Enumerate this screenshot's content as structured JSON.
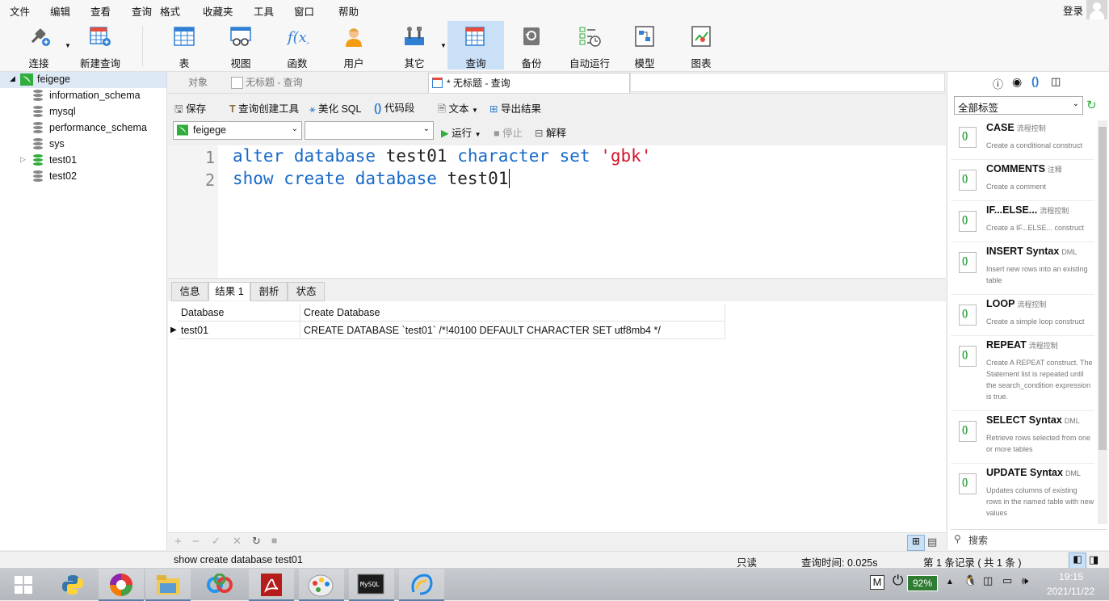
{
  "menu": [
    "文件",
    "编辑",
    "查看",
    "查询",
    "格式",
    "收藏夹",
    "工具",
    "窗口",
    "帮助"
  ],
  "login": "登录",
  "toolbar": {
    "connect": "连接",
    "new_query": "新建查询",
    "table": "表",
    "view": "视图",
    "function": "函数",
    "user": "用户",
    "other": "其它",
    "query": "查询",
    "backup": "备份",
    "auto_run": "自动运行",
    "model": "模型",
    "chart": "图表"
  },
  "tree": {
    "connection": "feigege",
    "databases": [
      "information_schema",
      "mysql",
      "performance_schema",
      "sys",
      "test01",
      "test02"
    ]
  },
  "tabs": {
    "objects": "对象",
    "untitled1": "无标题 - 查询",
    "untitled2": "* 无标题 - 查询"
  },
  "query_toolbar": {
    "save": "保存",
    "builder": "查询创建工具",
    "beautify": "美化 SQL",
    "snippet": "代码段",
    "text": "文本",
    "export": "导出结果",
    "connection": "feigege",
    "database": "",
    "run": "运行",
    "stop": "停止",
    "explain": "解释"
  },
  "editor": {
    "lines": [
      {
        "num": "1",
        "parts": [
          [
            "kw",
            "alter"
          ],
          [
            "sp",
            " "
          ],
          [
            "kw",
            "database"
          ],
          [
            "sp",
            " "
          ],
          [
            "id",
            "test01"
          ],
          [
            "sp",
            " "
          ],
          [
            "kw",
            "character"
          ],
          [
            "sp",
            " "
          ],
          [
            "kw",
            "set"
          ],
          [
            "sp",
            " "
          ],
          [
            "str",
            "'gbk'"
          ]
        ]
      },
      {
        "num": "2",
        "parts": [
          [
            "kw",
            "show"
          ],
          [
            "sp",
            " "
          ],
          [
            "kw",
            "create"
          ],
          [
            "sp",
            " "
          ],
          [
            "kw",
            "database"
          ],
          [
            "sp",
            " "
          ],
          [
            "id",
            "test01"
          ]
        ]
      }
    ]
  },
  "result_tabs": [
    "信息",
    "结果 1",
    "剖析",
    "状态"
  ],
  "grid": {
    "columns": [
      "Database",
      "Create Database"
    ],
    "rows": [
      [
        "test01",
        "CREATE DATABASE `test01` /*!40100 DEFAULT CHARACTER SET utf8mb4 */"
      ]
    ]
  },
  "right_panel": {
    "filter": "全部标签",
    "search_placeholder": "搜索",
    "snippets": [
      {
        "title": "CASE",
        "tag": "流程控制",
        "desc": "Create a conditional construct"
      },
      {
        "title": "COMMENTS",
        "tag": "注释",
        "desc": "Create a comment"
      },
      {
        "title": "IF...ELSE...",
        "tag": "流程控制",
        "desc": "Create a IF...ELSE... construct"
      },
      {
        "title": "INSERT Syntax",
        "tag": "DML",
        "desc": "Insert new rows into an existing table"
      },
      {
        "title": "LOOP",
        "tag": "流程控制",
        "desc": "Create a simple loop construct"
      },
      {
        "title": "REPEAT",
        "tag": "流程控制",
        "desc": "Create A REPEAT construct. The Statement list is repeated until the search_condition expression is true."
      },
      {
        "title": "SELECT Syntax",
        "tag": "DML",
        "desc": "Retrieve rows selected from one or more tables"
      },
      {
        "title": "UPDATE Syntax",
        "tag": "DML",
        "desc": "Updates columns of existing rows in the named table with new values"
      }
    ]
  },
  "status": {
    "sql": "show create database test01",
    "readonly": "只读",
    "time": "查询时间: 0.025s",
    "records": "第 1 条记录 ( 共 1 条 )"
  },
  "taskbar": {
    "ime": "M",
    "battery": "92%",
    "time": "19:15",
    "date": "2021/11/22"
  },
  "colors": {
    "keyword": "#1769c9",
    "string": "#d4152b",
    "active_tool": "#c9e0f6",
    "db_green": "#2fae3c"
  }
}
